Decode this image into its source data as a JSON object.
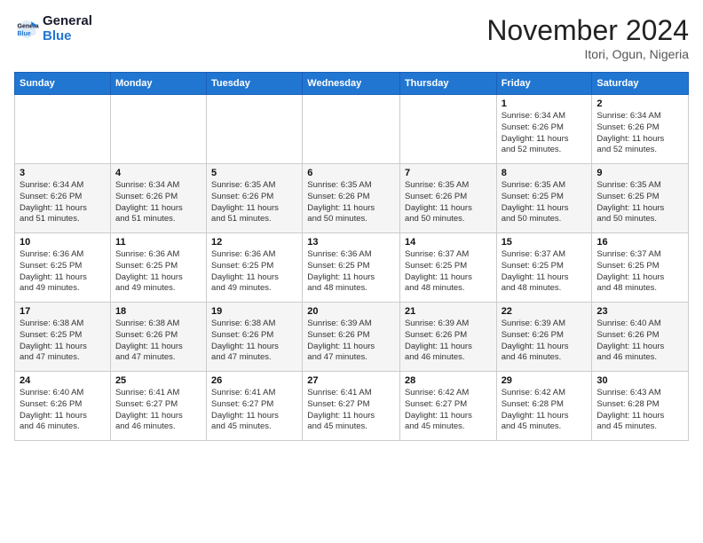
{
  "logo": {
    "line1": "General",
    "line2": "Blue"
  },
  "title": "November 2024",
  "location": "Itori, Ogun, Nigeria",
  "days_header": [
    "Sunday",
    "Monday",
    "Tuesday",
    "Wednesday",
    "Thursday",
    "Friday",
    "Saturday"
  ],
  "weeks": [
    [
      {
        "day": "",
        "info": ""
      },
      {
        "day": "",
        "info": ""
      },
      {
        "day": "",
        "info": ""
      },
      {
        "day": "",
        "info": ""
      },
      {
        "day": "",
        "info": ""
      },
      {
        "day": "1",
        "info": "Sunrise: 6:34 AM\nSunset: 6:26 PM\nDaylight: 11 hours\nand 52 minutes."
      },
      {
        "day": "2",
        "info": "Sunrise: 6:34 AM\nSunset: 6:26 PM\nDaylight: 11 hours\nand 52 minutes."
      }
    ],
    [
      {
        "day": "3",
        "info": "Sunrise: 6:34 AM\nSunset: 6:26 PM\nDaylight: 11 hours\nand 51 minutes."
      },
      {
        "day": "4",
        "info": "Sunrise: 6:34 AM\nSunset: 6:26 PM\nDaylight: 11 hours\nand 51 minutes."
      },
      {
        "day": "5",
        "info": "Sunrise: 6:35 AM\nSunset: 6:26 PM\nDaylight: 11 hours\nand 51 minutes."
      },
      {
        "day": "6",
        "info": "Sunrise: 6:35 AM\nSunset: 6:26 PM\nDaylight: 11 hours\nand 50 minutes."
      },
      {
        "day": "7",
        "info": "Sunrise: 6:35 AM\nSunset: 6:26 PM\nDaylight: 11 hours\nand 50 minutes."
      },
      {
        "day": "8",
        "info": "Sunrise: 6:35 AM\nSunset: 6:25 PM\nDaylight: 11 hours\nand 50 minutes."
      },
      {
        "day": "9",
        "info": "Sunrise: 6:35 AM\nSunset: 6:25 PM\nDaylight: 11 hours\nand 50 minutes."
      }
    ],
    [
      {
        "day": "10",
        "info": "Sunrise: 6:36 AM\nSunset: 6:25 PM\nDaylight: 11 hours\nand 49 minutes."
      },
      {
        "day": "11",
        "info": "Sunrise: 6:36 AM\nSunset: 6:25 PM\nDaylight: 11 hours\nand 49 minutes."
      },
      {
        "day": "12",
        "info": "Sunrise: 6:36 AM\nSunset: 6:25 PM\nDaylight: 11 hours\nand 49 minutes."
      },
      {
        "day": "13",
        "info": "Sunrise: 6:36 AM\nSunset: 6:25 PM\nDaylight: 11 hours\nand 48 minutes."
      },
      {
        "day": "14",
        "info": "Sunrise: 6:37 AM\nSunset: 6:25 PM\nDaylight: 11 hours\nand 48 minutes."
      },
      {
        "day": "15",
        "info": "Sunrise: 6:37 AM\nSunset: 6:25 PM\nDaylight: 11 hours\nand 48 minutes."
      },
      {
        "day": "16",
        "info": "Sunrise: 6:37 AM\nSunset: 6:25 PM\nDaylight: 11 hours\nand 48 minutes."
      }
    ],
    [
      {
        "day": "17",
        "info": "Sunrise: 6:38 AM\nSunset: 6:25 PM\nDaylight: 11 hours\nand 47 minutes."
      },
      {
        "day": "18",
        "info": "Sunrise: 6:38 AM\nSunset: 6:26 PM\nDaylight: 11 hours\nand 47 minutes."
      },
      {
        "day": "19",
        "info": "Sunrise: 6:38 AM\nSunset: 6:26 PM\nDaylight: 11 hours\nand 47 minutes."
      },
      {
        "day": "20",
        "info": "Sunrise: 6:39 AM\nSunset: 6:26 PM\nDaylight: 11 hours\nand 47 minutes."
      },
      {
        "day": "21",
        "info": "Sunrise: 6:39 AM\nSunset: 6:26 PM\nDaylight: 11 hours\nand 46 minutes."
      },
      {
        "day": "22",
        "info": "Sunrise: 6:39 AM\nSunset: 6:26 PM\nDaylight: 11 hours\nand 46 minutes."
      },
      {
        "day": "23",
        "info": "Sunrise: 6:40 AM\nSunset: 6:26 PM\nDaylight: 11 hours\nand 46 minutes."
      }
    ],
    [
      {
        "day": "24",
        "info": "Sunrise: 6:40 AM\nSunset: 6:26 PM\nDaylight: 11 hours\nand 46 minutes."
      },
      {
        "day": "25",
        "info": "Sunrise: 6:41 AM\nSunset: 6:27 PM\nDaylight: 11 hours\nand 46 minutes."
      },
      {
        "day": "26",
        "info": "Sunrise: 6:41 AM\nSunset: 6:27 PM\nDaylight: 11 hours\nand 45 minutes."
      },
      {
        "day": "27",
        "info": "Sunrise: 6:41 AM\nSunset: 6:27 PM\nDaylight: 11 hours\nand 45 minutes."
      },
      {
        "day": "28",
        "info": "Sunrise: 6:42 AM\nSunset: 6:27 PM\nDaylight: 11 hours\nand 45 minutes."
      },
      {
        "day": "29",
        "info": "Sunrise: 6:42 AM\nSunset: 6:28 PM\nDaylight: 11 hours\nand 45 minutes."
      },
      {
        "day": "30",
        "info": "Sunrise: 6:43 AM\nSunset: 6:28 PM\nDaylight: 11 hours\nand 45 minutes."
      }
    ]
  ]
}
